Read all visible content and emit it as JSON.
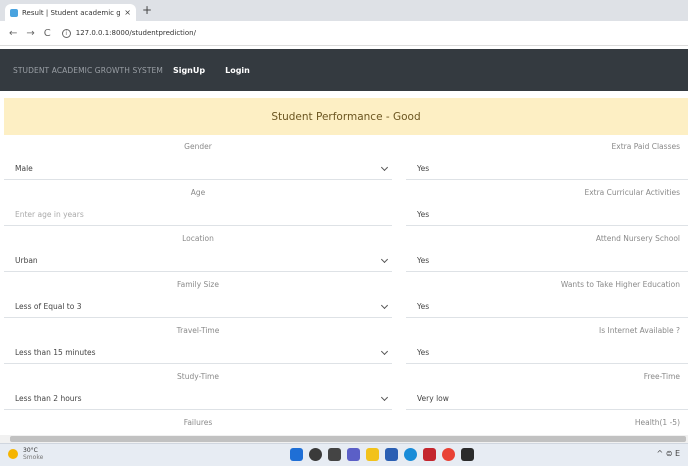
{
  "browser": {
    "tab_title": "Result | Student academic growt",
    "tab_close": "×",
    "new_tab": "+",
    "back": "←",
    "forward": "→",
    "reload": "C",
    "url": "127.0.0.1:8000/studentprediction/"
  },
  "navbar": {
    "brand": "STUDENT ACADEMIC GROWTH SYSTEM",
    "links": [
      "SignUp",
      "Login"
    ]
  },
  "result": {
    "text": "Student Performance - Good"
  },
  "form": {
    "left": [
      {
        "label": "Gender",
        "value": "Male",
        "type": "select"
      },
      {
        "label": "Age",
        "placeholder": "Enter age in years",
        "type": "input"
      },
      {
        "label": "Location",
        "value": "Urban",
        "type": "select"
      },
      {
        "label": "Family Size",
        "value": "Less of Equal to 3",
        "type": "select"
      },
      {
        "label": "Travel-Time",
        "value": "Less than 15 minutes",
        "type": "select"
      },
      {
        "label": "Study-Time",
        "value": "Less than 2 hours",
        "type": "select"
      },
      {
        "label": "Failures"
      }
    ],
    "right": [
      {
        "label": "Extra Paid Classes",
        "value": "Yes"
      },
      {
        "label": "Extra Curricular Activities",
        "value": "Yes"
      },
      {
        "label": "Attend Nursery School",
        "value": "Yes"
      },
      {
        "label": "Wants to Take Higher Education",
        "value": "Yes"
      },
      {
        "label": "Is Internet Available ?",
        "value": "Yes"
      },
      {
        "label": "Free-Time",
        "value": "Very low"
      },
      {
        "label": "Health(1 -5)"
      }
    ]
  },
  "taskbar": {
    "temperature": "30°C",
    "condition": "Smoke",
    "tray": "^ ⊜ E"
  },
  "colors": {
    "navbar": "#343a40",
    "banner": "#fdefc4"
  }
}
